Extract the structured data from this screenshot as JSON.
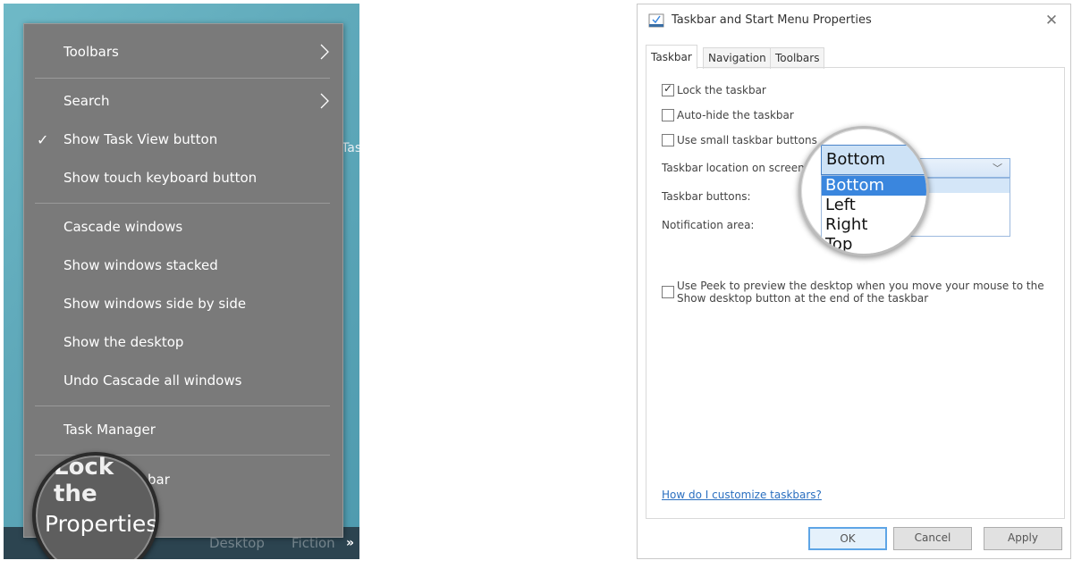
{
  "context_menu": {
    "items": [
      {
        "label": "Toolbars",
        "submenu": true,
        "checked": false
      },
      {
        "label": "Search",
        "submenu": true,
        "checked": false
      },
      {
        "label": "Show Task View button",
        "submenu": false,
        "checked": true
      },
      {
        "label": "Show touch keyboard button",
        "submenu": false,
        "checked": false
      },
      {
        "label": "Cascade windows",
        "submenu": false,
        "checked": false
      },
      {
        "label": "Show windows stacked",
        "submenu": false,
        "checked": false
      },
      {
        "label": "Show windows side by side",
        "submenu": false,
        "checked": false
      },
      {
        "label": "Show the desktop",
        "submenu": false,
        "checked": false
      },
      {
        "label": "Undo Cascade all windows",
        "submenu": false,
        "checked": false
      },
      {
        "label": "Task Manager",
        "submenu": false,
        "checked": false
      },
      {
        "label": "Lock the taskbar",
        "submenu": false,
        "checked": true,
        "visible_text": "bar"
      },
      {
        "label": "Properties",
        "submenu": false,
        "checked": false
      }
    ],
    "magnifier_top_text": "Lock the",
    "magnifier_main_text": "Properties"
  },
  "desktop": {
    "edge_text": "Tas",
    "taskbar_faded_left": "Desktop",
    "taskbar_faded_right": "Fiction",
    "chevron": "»"
  },
  "dialog": {
    "title": "Taskbar and Start Menu Properties",
    "close_glyph": "✕",
    "tabs": [
      "Taskbar",
      "Navigation",
      "Toolbars"
    ],
    "active_tab": "Taskbar",
    "checkboxes": [
      {
        "label": "Lock the taskbar",
        "checked": true
      },
      {
        "label": "Auto-hide the taskbar",
        "checked": false
      },
      {
        "label": "Use small taskbar buttons",
        "checked": false
      }
    ],
    "location_label": "Taskbar location on screen:",
    "buttons_label": "Taskbar buttons:",
    "notification_label": "Notification area:",
    "location_selected": "Bottom",
    "location_options": [
      "Bottom",
      "Left",
      "Right",
      "Top"
    ],
    "peek_label": "Use Peek to preview the desktop when you move your mouse to the Show desktop button at the end of the taskbar",
    "peek_checked": false,
    "help_link": "How do I customize taskbars?",
    "ok_label": "OK",
    "cancel_label": "Cancel",
    "apply_label": "Apply",
    "accent_color": "#3a86de"
  }
}
